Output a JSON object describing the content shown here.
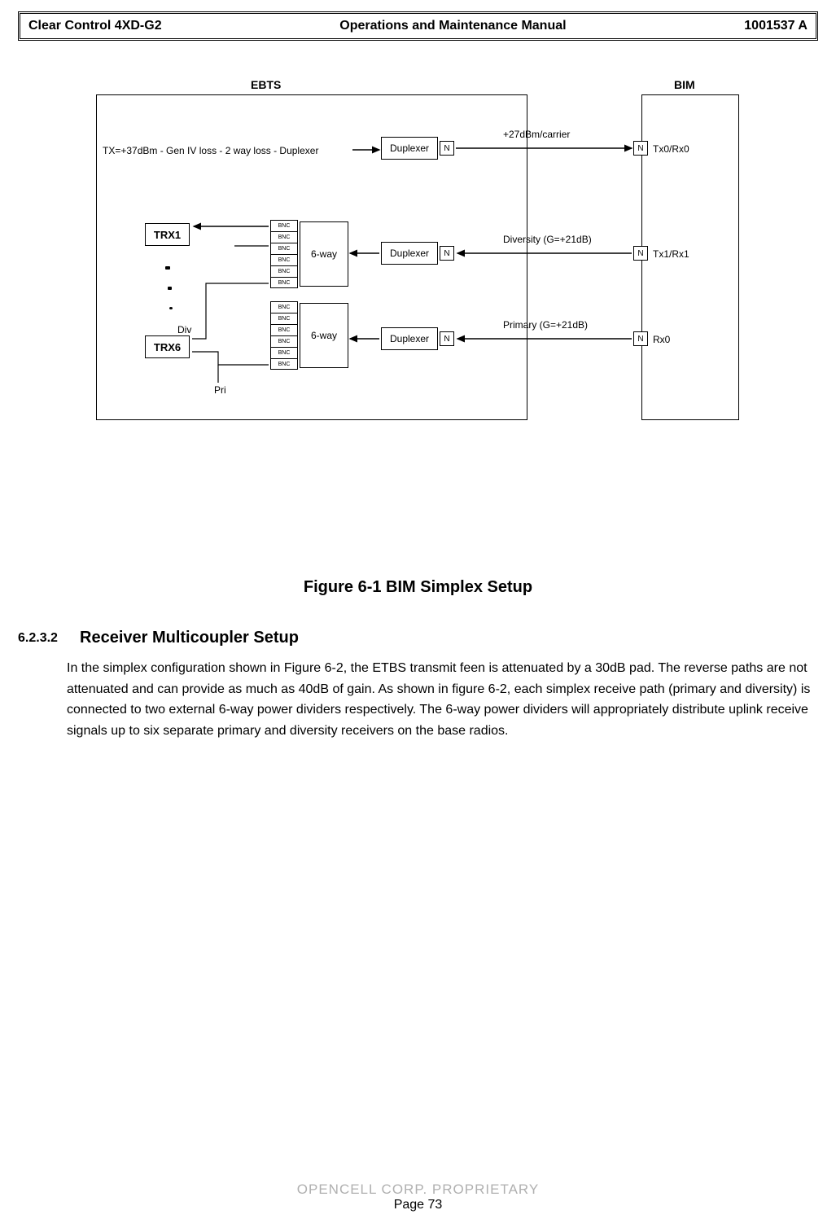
{
  "header": {
    "left": "Clear Control 4XD-G2",
    "center": "Operations and Maintenance Manual",
    "right": "1001537 A"
  },
  "diagram": {
    "ebts_label": "EBTS",
    "bim_label": "BIM",
    "tx_label": "TX=+37dBm - Gen IV loss - 2 way loss - Duplexer",
    "duplexer": "Duplexer",
    "n": "N",
    "sixway": "6-way",
    "bnc": "BNC",
    "trx1": "TRX1",
    "trx6": "TRX6",
    "div": "Div",
    "pri": "Pri",
    "p27": "+27dBm/carrier",
    "diversity": "Diversity (G=+21dB)",
    "primary": "Primary (G=+21dB)",
    "tx0rx0": "Tx0/Rx0",
    "tx1rx1": "Tx1/Rx1",
    "rx0": "Rx0"
  },
  "figure_caption": "Figure 6-1 BIM Simplex Setup",
  "section": {
    "number": "6.2.3.2",
    "title": "Receiver Multicoupler Setup",
    "body": "In the simplex configuration shown in Figure 6-2, the ETBS transmit feen is attenuated by a 30dB pad.  The reverse paths are not attenuated and can provide as much as 40dB of gain.  As shown in figure 6-2, each simplex receive path (primary and diversity) is connected to two external 6-way power dividers respectively.  The 6-way power dividers will appropriately distribute uplink receive signals up to six separate primary and diversity receivers on the base radios."
  },
  "footer": {
    "proprietary": "OPENCELL CORP.  PROPRIETARY",
    "page": "Page 73"
  }
}
